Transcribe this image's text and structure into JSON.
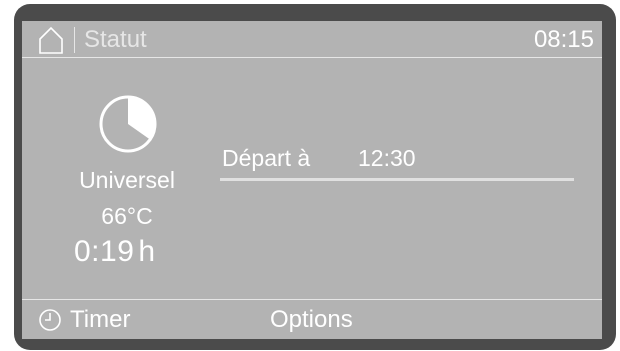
{
  "header": {
    "title": "Statut",
    "time": "08:15"
  },
  "program": {
    "icon": "partial-pie-progress-icon",
    "name": "Universel",
    "temperature": "66°C",
    "duration_value": "0:19",
    "duration_unit": "h"
  },
  "start": {
    "label": "Départ à",
    "time": "12:30"
  },
  "footer": {
    "timer_label": "Timer",
    "options_label": "Options"
  },
  "colors": {
    "bezel": "#4b4b4b",
    "screen_background": "#b3b3b3",
    "text": "#ffffff"
  }
}
